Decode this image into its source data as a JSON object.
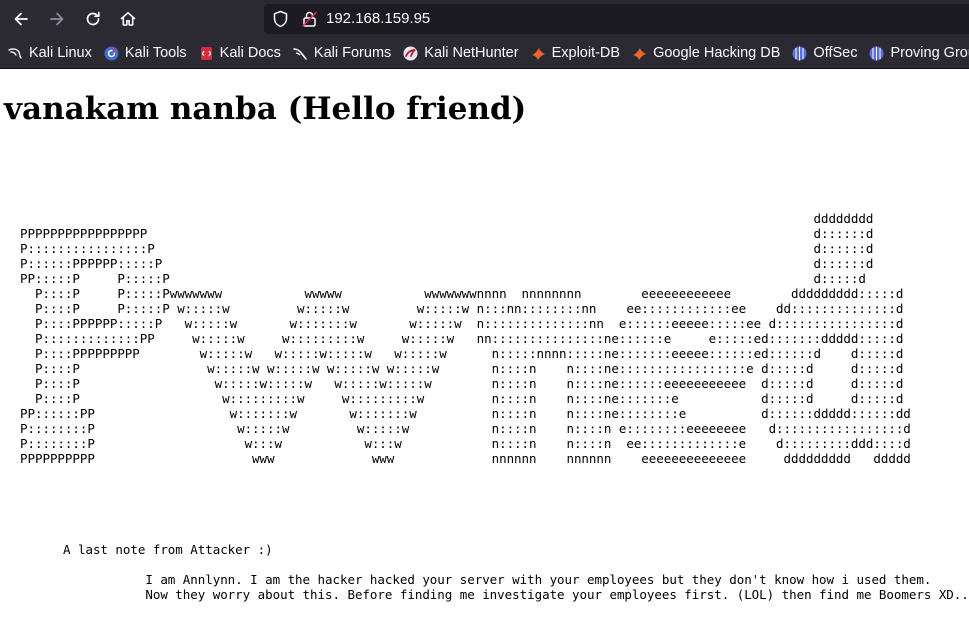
{
  "browser": {
    "url": "192.168.159.95",
    "bookmarks": [
      {
        "label": "Kali Linux",
        "icon": "kali-dragon-icon"
      },
      {
        "label": "Kali Tools",
        "icon": "kali-tools-icon"
      },
      {
        "label": "Kali Docs",
        "icon": "kali-docs-icon"
      },
      {
        "label": "Kali Forums",
        "icon": "kali-forums-icon"
      },
      {
        "label": "Kali NetHunter",
        "icon": "nethunter-icon"
      },
      {
        "label": "Exploit-DB",
        "icon": "exploit-db-icon"
      },
      {
        "label": "Google Hacking DB",
        "icon": "ghdb-icon"
      },
      {
        "label": "OffSec",
        "icon": "offsec-icon"
      },
      {
        "label": "Proving Grou",
        "icon": "proving-grounds-icon"
      }
    ],
    "colors": {
      "chrome_bg": "#2b2a33",
      "urlbar_bg": "#1c1b22",
      "text": "#fbfbfe"
    }
  },
  "page": {
    "title": "vanakam nanba (Hello friend)",
    "ascii_art": "                                                                                                          dddddddd\nPPPPPPPPPPPPPPPPP                                                                                         d::::::d\nP::::::::::::::::P                                                                                        d::::::d\nP::::::PPPPPP:::::P                                                                                       d::::::d\nPP:::::P     P:::::P                                                                                      d:::::d\n  P::::P     P:::::Pwwwwwww           wwwww           wwwwwwwnnnn  nnnnnnnn        eeeeeeeeeeee        ddddddddd:::::d\n  P::::P     P:::::P w:::::w         w:::::w         w:::::w n:::nn::::::::nn    ee::::::::::::ee    dd::::::::::::::d\n  P::::PPPPPP:::::P   w:::::w       w:::::::w       w:::::w  n::::::::::::::nn  e::::::eeeee:::::ee d::::::::::::::::d\n  P:::::::::::::PP     w:::::w     w:::::::::w     w:::::w   nn:::::::::::::::ne::::::e     e:::::ed:::::::ddddd:::::d\n  P::::PPPPPPPPP        w:::::w   w:::::w:::::w   w:::::w      n:::::nnnn:::::ne:::::::eeeee::::::ed::::::d    d:::::d\n  P::::P                 w:::::w w:::::w w:::::w w:::::w       n::::n    n::::ne:::::::::::::::::e d:::::d     d:::::d\n  P::::P                  w:::::w:::::w   w:::::w:::::w        n::::n    n::::ne::::::eeeeeeeeeee  d:::::d     d:::::d\n  P::::P                   w:::::::::w     w:::::::::w         n::::n    n::::ne:::::::e           d:::::d     d:::::d\nPP::::::PP                  w:::::::w       w:::::::w          n::::n    n::::ne::::::::e          d::::::ddddd::::::dd\nP::::::::P                   w:::::w         w:::::w           n::::n    n::::n e::::::::eeeeeeee   d:::::::::::::::::d\nP::::::::P                    w:::w           w:::w            n::::n    n::::n  ee:::::::::::::e    d:::::::::ddd::::d\nPPPPPPPPPP                     www             www             nnnnnn    nnnnnn    eeeeeeeeeeeeee     ddddddddd   ddddd",
    "note_heading": "A last note from Attacker :)",
    "note_line1": "I am Annlynn. I am the hacker hacked your server with your employees but they don't know how i used them.",
    "note_line2": "Now they worry about this. Before finding me investigate your employees first. (LOL) then find me Boomers XD..!!"
  }
}
